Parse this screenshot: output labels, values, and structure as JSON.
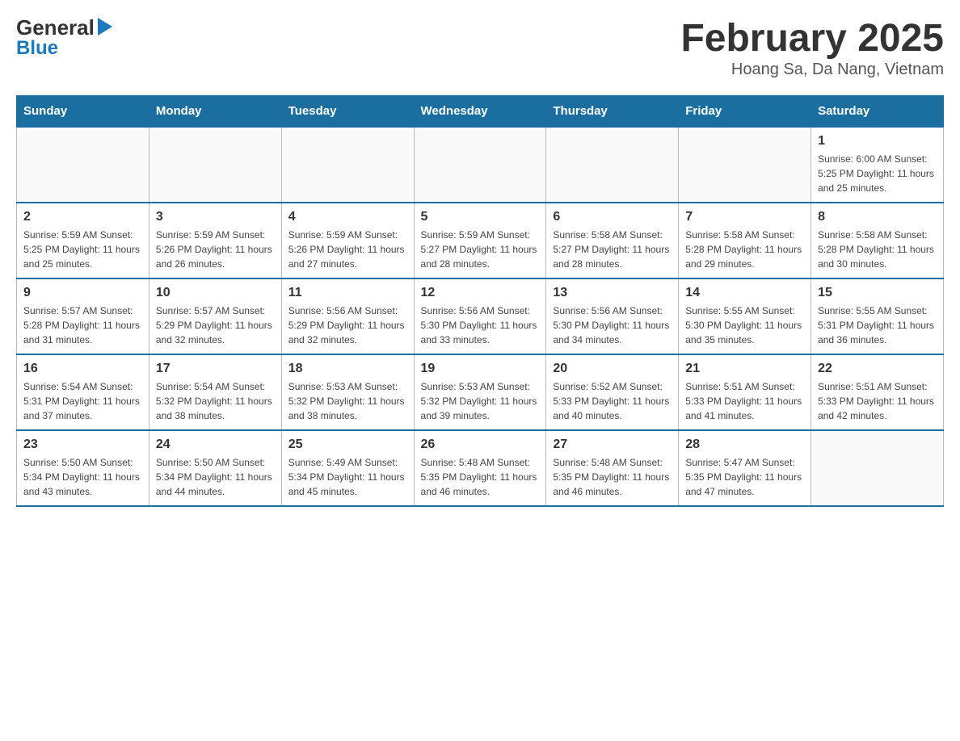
{
  "header": {
    "title": "February 2025",
    "subtitle": "Hoang Sa, Da Nang, Vietnam",
    "logo_general": "General",
    "logo_blue": "Blue"
  },
  "calendar": {
    "days_of_week": [
      "Sunday",
      "Monday",
      "Tuesday",
      "Wednesday",
      "Thursday",
      "Friday",
      "Saturday"
    ],
    "weeks": [
      [
        {
          "day": "",
          "info": ""
        },
        {
          "day": "",
          "info": ""
        },
        {
          "day": "",
          "info": ""
        },
        {
          "day": "",
          "info": ""
        },
        {
          "day": "",
          "info": ""
        },
        {
          "day": "",
          "info": ""
        },
        {
          "day": "1",
          "info": "Sunrise: 6:00 AM\nSunset: 5:25 PM\nDaylight: 11 hours and 25 minutes."
        }
      ],
      [
        {
          "day": "2",
          "info": "Sunrise: 5:59 AM\nSunset: 5:25 PM\nDaylight: 11 hours and 25 minutes."
        },
        {
          "day": "3",
          "info": "Sunrise: 5:59 AM\nSunset: 5:26 PM\nDaylight: 11 hours and 26 minutes."
        },
        {
          "day": "4",
          "info": "Sunrise: 5:59 AM\nSunset: 5:26 PM\nDaylight: 11 hours and 27 minutes."
        },
        {
          "day": "5",
          "info": "Sunrise: 5:59 AM\nSunset: 5:27 PM\nDaylight: 11 hours and 28 minutes."
        },
        {
          "day": "6",
          "info": "Sunrise: 5:58 AM\nSunset: 5:27 PM\nDaylight: 11 hours and 28 minutes."
        },
        {
          "day": "7",
          "info": "Sunrise: 5:58 AM\nSunset: 5:28 PM\nDaylight: 11 hours and 29 minutes."
        },
        {
          "day": "8",
          "info": "Sunrise: 5:58 AM\nSunset: 5:28 PM\nDaylight: 11 hours and 30 minutes."
        }
      ],
      [
        {
          "day": "9",
          "info": "Sunrise: 5:57 AM\nSunset: 5:28 PM\nDaylight: 11 hours and 31 minutes."
        },
        {
          "day": "10",
          "info": "Sunrise: 5:57 AM\nSunset: 5:29 PM\nDaylight: 11 hours and 32 minutes."
        },
        {
          "day": "11",
          "info": "Sunrise: 5:56 AM\nSunset: 5:29 PM\nDaylight: 11 hours and 32 minutes."
        },
        {
          "day": "12",
          "info": "Sunrise: 5:56 AM\nSunset: 5:30 PM\nDaylight: 11 hours and 33 minutes."
        },
        {
          "day": "13",
          "info": "Sunrise: 5:56 AM\nSunset: 5:30 PM\nDaylight: 11 hours and 34 minutes."
        },
        {
          "day": "14",
          "info": "Sunrise: 5:55 AM\nSunset: 5:30 PM\nDaylight: 11 hours and 35 minutes."
        },
        {
          "day": "15",
          "info": "Sunrise: 5:55 AM\nSunset: 5:31 PM\nDaylight: 11 hours and 36 minutes."
        }
      ],
      [
        {
          "day": "16",
          "info": "Sunrise: 5:54 AM\nSunset: 5:31 PM\nDaylight: 11 hours and 37 minutes."
        },
        {
          "day": "17",
          "info": "Sunrise: 5:54 AM\nSunset: 5:32 PM\nDaylight: 11 hours and 38 minutes."
        },
        {
          "day": "18",
          "info": "Sunrise: 5:53 AM\nSunset: 5:32 PM\nDaylight: 11 hours and 38 minutes."
        },
        {
          "day": "19",
          "info": "Sunrise: 5:53 AM\nSunset: 5:32 PM\nDaylight: 11 hours and 39 minutes."
        },
        {
          "day": "20",
          "info": "Sunrise: 5:52 AM\nSunset: 5:33 PM\nDaylight: 11 hours and 40 minutes."
        },
        {
          "day": "21",
          "info": "Sunrise: 5:51 AM\nSunset: 5:33 PM\nDaylight: 11 hours and 41 minutes."
        },
        {
          "day": "22",
          "info": "Sunrise: 5:51 AM\nSunset: 5:33 PM\nDaylight: 11 hours and 42 minutes."
        }
      ],
      [
        {
          "day": "23",
          "info": "Sunrise: 5:50 AM\nSunset: 5:34 PM\nDaylight: 11 hours and 43 minutes."
        },
        {
          "day": "24",
          "info": "Sunrise: 5:50 AM\nSunset: 5:34 PM\nDaylight: 11 hours and 44 minutes."
        },
        {
          "day": "25",
          "info": "Sunrise: 5:49 AM\nSunset: 5:34 PM\nDaylight: 11 hours and 45 minutes."
        },
        {
          "day": "26",
          "info": "Sunrise: 5:48 AM\nSunset: 5:35 PM\nDaylight: 11 hours and 46 minutes."
        },
        {
          "day": "27",
          "info": "Sunrise: 5:48 AM\nSunset: 5:35 PM\nDaylight: 11 hours and 46 minutes."
        },
        {
          "day": "28",
          "info": "Sunrise: 5:47 AM\nSunset: 5:35 PM\nDaylight: 11 hours and 47 minutes."
        },
        {
          "day": "",
          "info": ""
        }
      ]
    ]
  }
}
